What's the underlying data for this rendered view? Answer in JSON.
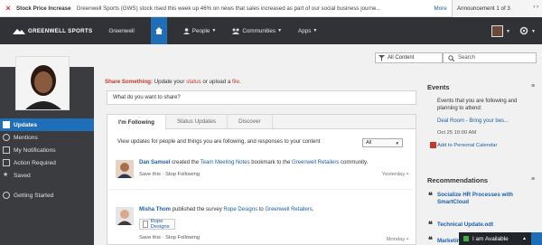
{
  "ticker": {
    "title": "Stock Price Increase",
    "text": "Greenwell Sports (GWS) stock rised this week up 46% on news that sales increased as part of our social business journe...",
    "more": "More",
    "announcement": "Announcement 1 of 3"
  },
  "nav": {
    "logo": "GREENWELL SPORTS",
    "org": "Greenwell",
    "people": "People",
    "communities": "Communities",
    "apps": "Apps"
  },
  "search": {
    "filter": "All Content",
    "placeholder": "Search"
  },
  "sidebar": {
    "items": [
      {
        "label": "Updates"
      },
      {
        "label": "Mentions"
      },
      {
        "label": "My Notifications"
      },
      {
        "label": "Action Required"
      },
      {
        "label": "Saved"
      },
      {
        "label": "Getting Started"
      }
    ]
  },
  "share": {
    "prefix": "Share Something:",
    "middle": " Update your ",
    "status": "status",
    "or": " or upload a ",
    "file": "file",
    "end": ".",
    "placeholder": "What do you want to share?"
  },
  "tabs": [
    "I'm Following",
    "Status Updates",
    "Discover"
  ],
  "feed": {
    "description": "View updates for people and things you are following, and responses to your content",
    "filter": "All",
    "posts": [
      {
        "name": "Dan Samuel",
        "verb": " created the ",
        "link1": "Team Meeting Notes",
        "mid": " bookmark to the ",
        "link2": "Greenwell Retailers",
        "end": " community.",
        "actions": "Save this  ·  Stop Following",
        "time": "Yesterday"
      },
      {
        "name": "Misha Thom",
        "verb": " published the survey ",
        "link1": "Rope Designs",
        "mid": " to ",
        "link2": "Greenwell Retailers",
        "end": ".",
        "doc": "Rope Designs",
        "actions": "Save this  ·  Stop Following",
        "time": "Monday"
      }
    ]
  },
  "events": {
    "title": "Events",
    "text": "Events that you are following and planning to attend:",
    "item": "Deal Room - Bring your bes...",
    "date": "Oct 25 10:00 AM",
    "add": "Add to Personal Calendar"
  },
  "recommendations": {
    "title": "Recommendations",
    "items": [
      "Socialize HR Processes with SmartCloud",
      "Technical Update.odt",
      "Marketing Update.odt"
    ]
  },
  "status": {
    "label": "I am Available"
  },
  "colors": {
    "accent": "#1e6fb8",
    "nav": "#303236",
    "sidebar": "#3a3c40",
    "share": "#c0392b"
  }
}
